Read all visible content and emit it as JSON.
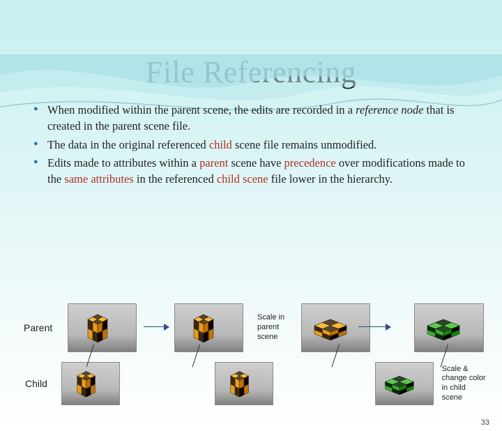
{
  "title": "File Referencing",
  "bullets": [
    {
      "pre": "When modified within the parent scene, the edits are recorded in a ",
      "emItal": "reference node",
      "post": " that is created in the parent scene file."
    },
    {
      "pre": "The data in the original referenced ",
      "red1": "child",
      "mid1": " scene file remains unmodified.",
      "red2": "",
      "mid2": "",
      "red3": "",
      "mid3": "",
      "red4": "",
      "post": ""
    },
    {
      "pre": "Edits made to attributes within a ",
      "red1": "parent",
      "mid1": " scene have ",
      "red2": "precedence",
      "mid2": " over modifications made to the ",
      "red3": "same attributes",
      "mid3": " in the referenced ",
      "red4": "child scene",
      "post": " file lower in the hierarchy."
    }
  ],
  "labels": {
    "parent": "Parent",
    "child": "Child",
    "scaleParent": "Scale in parent scene",
    "scaleChild": "Scale & change color in child scene"
  },
  "colors": {
    "orange_dark": "#3a2a0a",
    "orange_light": "#e89a1a",
    "green_dark": "#0a2a0a",
    "green_light": "#3aaf2a"
  },
  "pageNumber": "33"
}
